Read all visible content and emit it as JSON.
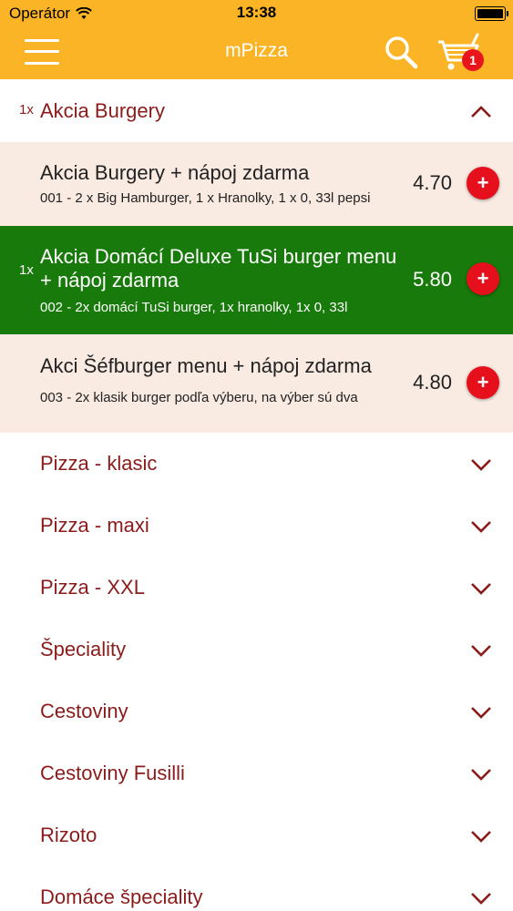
{
  "status_bar": {
    "carrier": "Operátor",
    "time": "13:38"
  },
  "header": {
    "title": "mPizza",
    "cart_count": "1"
  },
  "expanded_category": {
    "label": "Akcia Burgery",
    "qty": "1x"
  },
  "products": [
    {
      "name": "Akcia Burgery + nápoj zdarma",
      "desc": "001 - 2 x Big Hamburger, 1 x Hranolky, 1 x 0, 33l pepsi",
      "price": "4.70",
      "add": "+"
    },
    {
      "qty": "1x",
      "name": "Akcia Domácí Deluxe TuSi burger menu + nápoj zdarma",
      "desc": "002 - 2x domácí TuSi burger, 1x hranolky, 1x 0, 33l",
      "price": "5.80",
      "add": "+"
    },
    {
      "name": "Akci Šéfburger menu + nápoj zdarma",
      "desc": "003 - 2x klasik burger podľa výberu, na výber sú dva",
      "price": "4.80",
      "add": "+"
    }
  ],
  "categories": [
    "Pizza - klasic",
    "Pizza - maxi",
    "Pizza - XXL",
    "Špeciality",
    "Cestoviny",
    "Cestoviny Fusilli",
    "Rizoto",
    "Domáce špeciality"
  ],
  "colors": {
    "header": "#fbb426",
    "accent": "#8b1b1b",
    "highlight": "#187a0b",
    "add_button": "#e60f1c",
    "product_bg": "#f9eae2"
  }
}
